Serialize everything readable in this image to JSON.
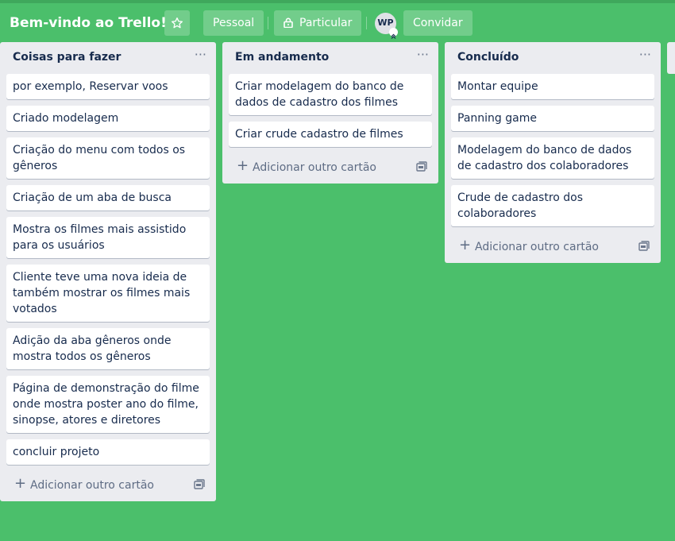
{
  "header": {
    "title": "Bem-vindo ao Trello!",
    "star_icon": "star-icon",
    "pessoal": "Pessoal",
    "particular": "Particular",
    "lock_icon": "lock-icon",
    "avatar": "WP",
    "convidar": "Convidar"
  },
  "lists": [
    {
      "title": "Coisas para fazer",
      "menu": "···",
      "cards": [
        "por exemplo, Reservar voos",
        "Criado modelagem",
        "Criação do menu com todos os gêneros",
        "Criação de um aba de busca",
        "Mostra os filmes mais assistido para os usuários",
        "Cliente teve uma nova ideia de também mostrar os filmes mais votados",
        "Adição da aba gêneros onde mostra todos os gêneros",
        "Página de demonstração do filme onde mostra poster ano do filme, sinopse, atores e diretores",
        "concluir projeto"
      ],
      "add_card": "Adicionar outro cartão"
    },
    {
      "title": "Em andamento",
      "menu": "···",
      "cards": [
        "Criar modelagem do banco de dados de cadastro dos filmes",
        "Criar crude cadastro de filmes"
      ],
      "add_card": "Adicionar outro cartão"
    },
    {
      "title": "Concluído",
      "menu": "···",
      "cards": [
        "Montar equipe",
        "Panning game",
        "Modelagem do banco de dados de cadastro dos colaboradores",
        "Crude de cadastro dos colaboradores"
      ],
      "add_card": "Adicionar outro cartão"
    }
  ],
  "colors": {
    "board_background": "#4bbf6b",
    "list_background": "#ebecf0",
    "card_text": "#172b4d"
  }
}
